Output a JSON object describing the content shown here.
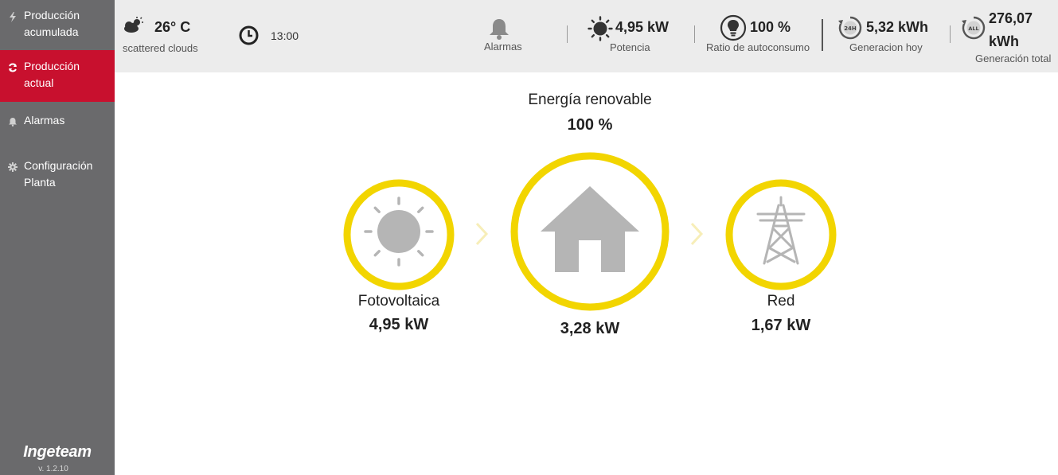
{
  "sidebar": {
    "items": [
      {
        "label_line1": "Producción",
        "label_line2": "acumulada",
        "icon": "bolt-icon",
        "active": false
      },
      {
        "label_line1": "Producción",
        "label_line2": "actual",
        "icon": "refresh-icon",
        "active": true
      },
      {
        "label_line1": "Alarmas",
        "label_line2": "",
        "icon": "bell-icon",
        "active": false
      },
      {
        "label_line1": "Configuración",
        "label_line2": "Planta",
        "icon": "gear-icon",
        "active": false
      }
    ],
    "brand": "Ingeteam",
    "version": "v. 1.2.10"
  },
  "header": {
    "weather": {
      "temperature": "26° C",
      "description": "scattered clouds",
      "icon": "cloud-icon"
    },
    "clock": {
      "time": "13:00",
      "icon": "clock-icon"
    },
    "alarms": {
      "label": "Alarmas",
      "icon": "bell-icon"
    },
    "power": {
      "value": "4,95 kW",
      "label": "Potencia",
      "icon": "sun-icon"
    },
    "self_consumption": {
      "value": "100 %",
      "label": "Ratio de autoconsumo",
      "icon": "lightbulb-icon"
    },
    "generation_today": {
      "value": "5,32 kWh",
      "label": "Generacion hoy",
      "icon": "24h-icon",
      "badge": "24H"
    },
    "generation_total": {
      "value_line1": "276,07",
      "value_line2": "kWh",
      "label": "Generación total",
      "icon": "all-icon",
      "badge": "ALL"
    }
  },
  "main": {
    "title": "Energía renovable",
    "percentage": "100 %",
    "nodes": {
      "pv": {
        "label": "Fotovoltaica",
        "value": "4,95 kW"
      },
      "home": {
        "value": "3,28 kW"
      },
      "grid": {
        "label": "Red",
        "value": "1,67 kW"
      }
    }
  },
  "colors": {
    "sidebar_bg": "#6a6a6c",
    "active_red": "#c8102e",
    "topbar_bg": "#ececec",
    "ring_yellow": "#f2d500",
    "icon_gray": "#b5b5b5"
  }
}
